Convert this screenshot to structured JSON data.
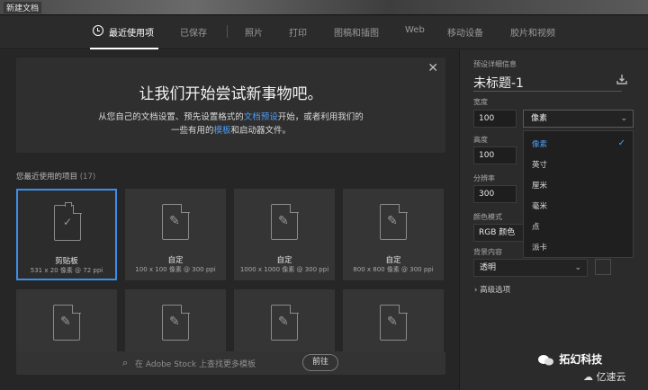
{
  "window": {
    "title": "新建文档"
  },
  "tabs": [
    {
      "label": "最近使用项",
      "active": true
    },
    {
      "label": "已保存"
    },
    {
      "label": "照片"
    },
    {
      "label": "打印"
    },
    {
      "label": "图稿和插图"
    },
    {
      "label": "Web"
    },
    {
      "label": "移动设备"
    },
    {
      "label": "胶片和视频"
    }
  ],
  "banner": {
    "heading": "让我们开始尝试新事物吧。",
    "line1_a": "从您自己的文档设置、预先设置格式的",
    "line1_link": "文档预设",
    "line1_b": "开始，或者利用我们的",
    "line2_a": "一些有用的",
    "line2_link": "模板",
    "line2_b": "和启动器文件。",
    "close": "✕"
  },
  "recent": {
    "label": "您最近使用的项目",
    "count": "(17)",
    "items": [
      {
        "name": "剪贴板",
        "size": "531 x 20 像素 @ 72 ppi",
        "selected": true
      },
      {
        "name": "自定",
        "size": "100 x 100 像素 @ 300 ppi"
      },
      {
        "name": "自定",
        "size": "1000 x 1000 像素 @ 300 ppi"
      },
      {
        "name": "自定",
        "size": "800 x 800 像素 @ 300 ppi"
      }
    ]
  },
  "search": {
    "placeholder": "在 Adobe Stock 上查找更多模板",
    "button": "前往"
  },
  "preset": {
    "section_label": "预设详细信息",
    "doc_name": "未标题-1",
    "width_label": "宽度",
    "width_value": "100",
    "unit_selected": "像素",
    "height_label": "高度",
    "height_value": "100",
    "resolution_label": "分辨率",
    "resolution_value": "300",
    "color_mode_label": "颜色模式",
    "color_mode_value": "RGB 颜色",
    "background_label": "背景内容",
    "background_value": "透明",
    "advanced_label": "高级选项",
    "unit_options": [
      "像素",
      "英寸",
      "厘米",
      "毫米",
      "点",
      "派卡"
    ]
  },
  "watermark": {
    "text": "拓幻科技",
    "badge": "亿速云"
  }
}
